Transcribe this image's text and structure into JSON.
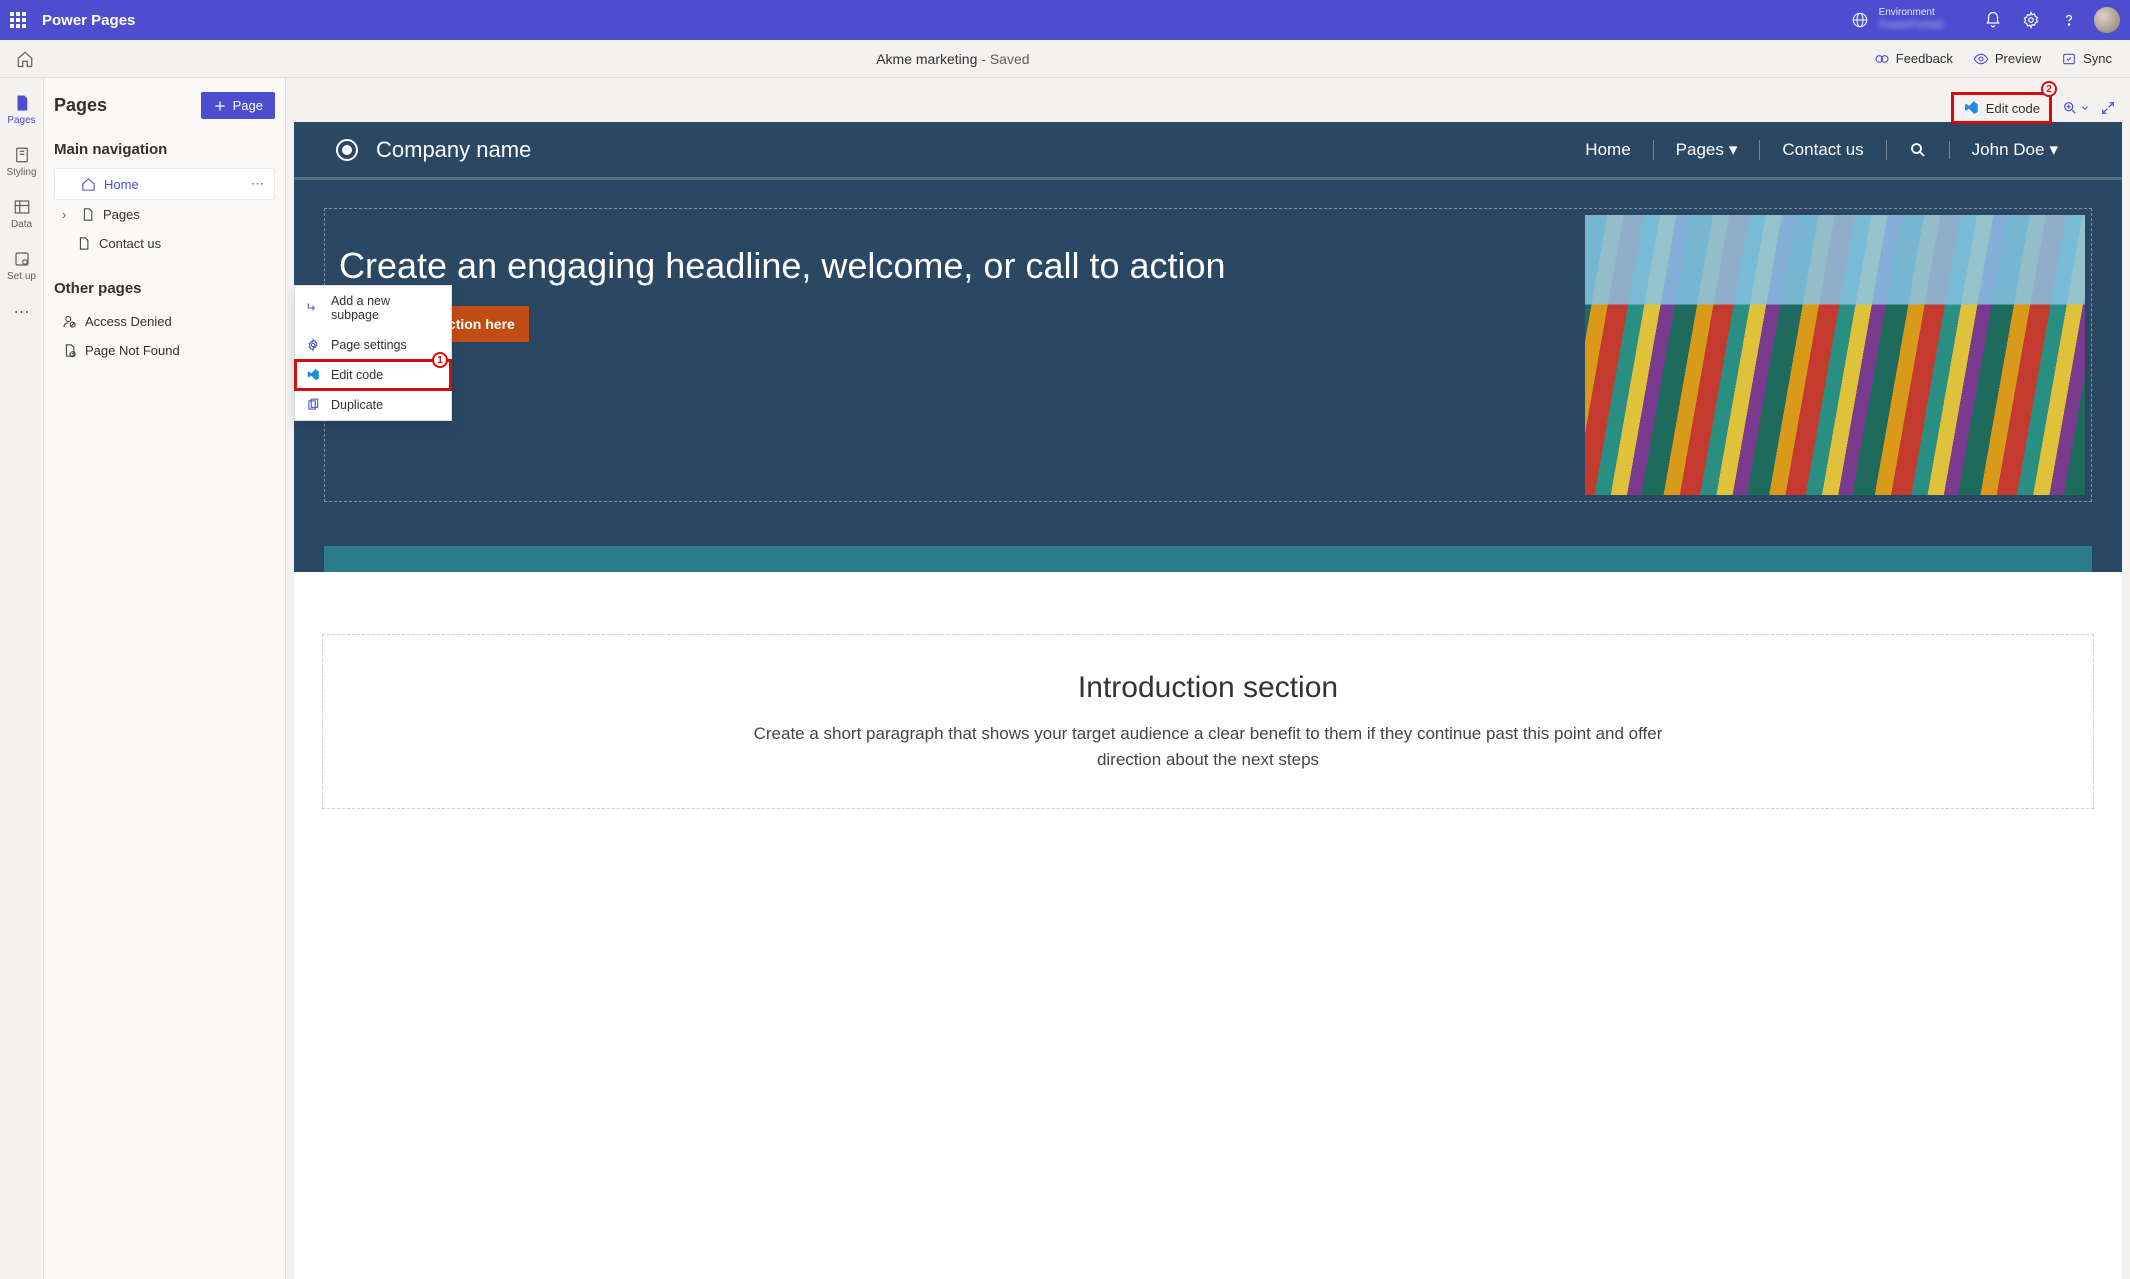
{
  "header": {
    "brand": "Power Pages",
    "environment_label": "Environment",
    "environment_value": "PowerPortals"
  },
  "cmdbar": {
    "site_name": "Akme marketing",
    "status": " - Saved",
    "feedback": "Feedback",
    "preview": "Preview",
    "sync": "Sync"
  },
  "rail": {
    "pages": "Pages",
    "styling": "Styling",
    "data": "Data",
    "setup": "Set up"
  },
  "pages_panel": {
    "title": "Pages",
    "add_page": "Page",
    "main_nav": "Main navigation",
    "items": {
      "home": "Home",
      "pages": "Pages",
      "contact": "Contact us"
    },
    "other_pages": "Other pages",
    "other": {
      "access_denied": "Access Denied",
      "not_found": "Page Not Found"
    }
  },
  "context_menu": {
    "add_subpage": "Add a new subpage",
    "page_settings": "Page settings",
    "edit_code": "Edit code",
    "duplicate": "Duplicate",
    "badge1": "1"
  },
  "canvas_toolbar": {
    "edit_code": "Edit code",
    "badge2": "2"
  },
  "site": {
    "company": "Company name",
    "nav": {
      "home": "Home",
      "pages": "Pages",
      "contact": "Contact us",
      "user": "John Doe"
    },
    "hero_headline": "Create an engaging headline, welcome, or call to action",
    "cta": "Add a call to action here",
    "intro_title": "Introduction section",
    "intro_text": "Create a short paragraph that shows your target audience a clear benefit to them if they continue past this point and offer direction about the next steps"
  }
}
